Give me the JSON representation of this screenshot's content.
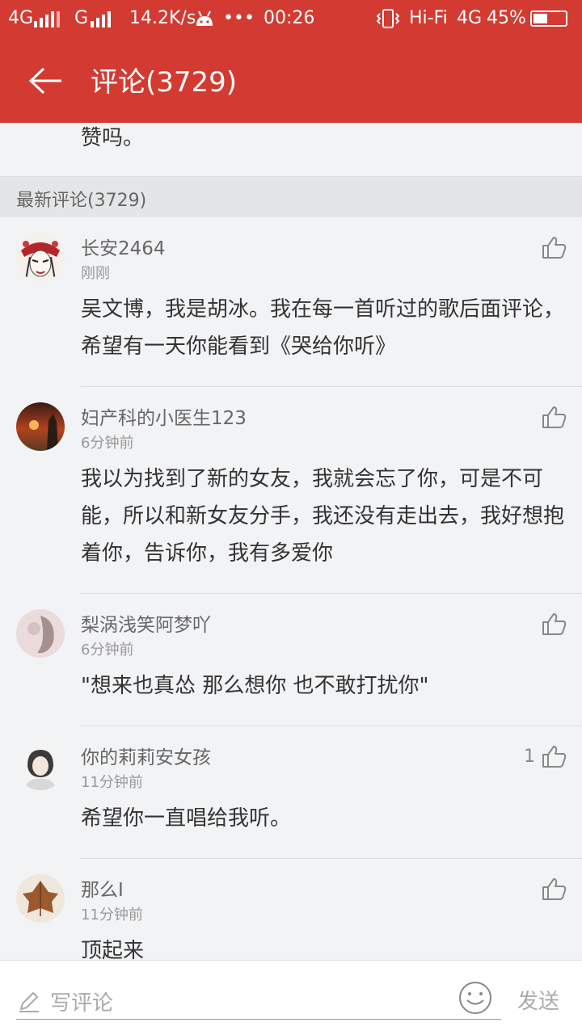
{
  "status_bar": {
    "network1": "4G",
    "network2": "G",
    "speed": "14.2K/s",
    "dots": "•••",
    "time": "00:26",
    "hifi": "Hi-Fi",
    "network3": "4G",
    "battery": "45%",
    "battery_level": 0.45
  },
  "header": {
    "title": "评论(3729)"
  },
  "previous_comment_tail": "赞吗。",
  "section": {
    "title": "最新评论(3729)"
  },
  "comments": [
    {
      "username": "长安2464",
      "time": "刚刚",
      "content": "吴文博，我是胡冰。我在每一首听过的歌后面评论，希望有一天你能看到《哭给你听》",
      "likes": ""
    },
    {
      "username": "妇产科的小医生123",
      "time": "6分钟前",
      "content": "我以为找到了新的女友，我就会忘了你，可是不可能，所以和新女友分手，我还没有走出去，我好想抱着你，告诉你，我有多爱你",
      "likes": ""
    },
    {
      "username": "梨涡浅笑阿梦吖",
      "time": "6分钟前",
      "content": "\"想来也真怂 那么想你 也不敢打扰你\"",
      "likes": ""
    },
    {
      "username": "你的莉莉安女孩",
      "time": "11分钟前",
      "content": "希望你一直唱给我听。",
      "likes": "1"
    },
    {
      "username": "那么I",
      "time": "11分钟前",
      "content": "顶起来",
      "likes": ""
    }
  ],
  "compose": {
    "placeholder": "写评论",
    "send_label": "发送"
  },
  "colors": {
    "brand_red": "#d33a31",
    "background": "#f2f3f5"
  },
  "icons": [
    "back-arrow-icon",
    "android-icon",
    "vibrate-icon",
    "battery-icon",
    "thumbs-up-icon",
    "pencil-icon",
    "smiley-icon"
  ]
}
